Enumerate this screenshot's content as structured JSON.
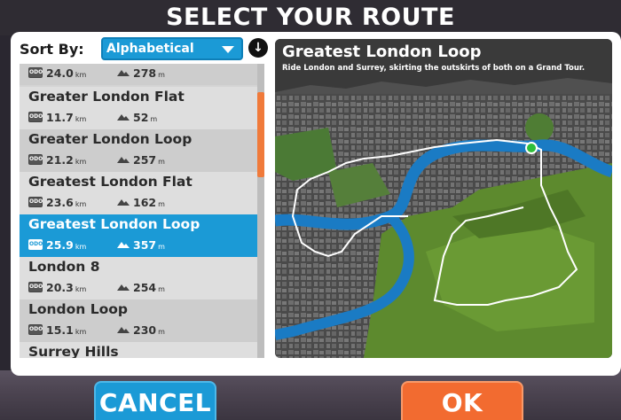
{
  "header": {
    "title": "SELECT YOUR ROUTE"
  },
  "sort": {
    "label": "Sort By:",
    "selected": "Alphabetical",
    "direction_icon": "arrow-down-circle-icon"
  },
  "routes": [
    {
      "name": "",
      "distance": "24.0",
      "distance_unit": "km",
      "elevation": "278",
      "elevation_unit": "m",
      "selected": false
    },
    {
      "name": "Greater London Flat",
      "distance": "11.7",
      "distance_unit": "km",
      "elevation": "52",
      "elevation_unit": "m",
      "selected": false
    },
    {
      "name": "Greater London Loop",
      "distance": "21.2",
      "distance_unit": "km",
      "elevation": "257",
      "elevation_unit": "m",
      "selected": false
    },
    {
      "name": "Greatest London Flat",
      "distance": "23.6",
      "distance_unit": "km",
      "elevation": "162",
      "elevation_unit": "m",
      "selected": false
    },
    {
      "name": "Greatest London Loop",
      "distance": "25.9",
      "distance_unit": "km",
      "elevation": "357",
      "elevation_unit": "m",
      "selected": true
    },
    {
      "name": "London 8",
      "distance": "20.3",
      "distance_unit": "km",
      "elevation": "254",
      "elevation_unit": "m",
      "selected": false
    },
    {
      "name": "London Loop",
      "distance": "15.1",
      "distance_unit": "km",
      "elevation": "230",
      "elevation_unit": "m",
      "selected": false
    },
    {
      "name": "Surrey Hills",
      "distance": "",
      "distance_unit": "",
      "elevation": "",
      "elevation_unit": "",
      "selected": false
    }
  ],
  "distance_icon_text": "ODO",
  "preview": {
    "title": "Greatest London Loop",
    "description": "Ride London and Surrey, skirting the outskirts of both on a Grand Tour."
  },
  "buttons": {
    "cancel": "CANCEL",
    "ok": "OK"
  },
  "colors": {
    "accent_blue": "#1b9ad6",
    "accent_orange": "#f26b30",
    "scroll_thumb": "#f07a3a",
    "river": "#1a7bc4",
    "hills": "#5d8a2e"
  }
}
